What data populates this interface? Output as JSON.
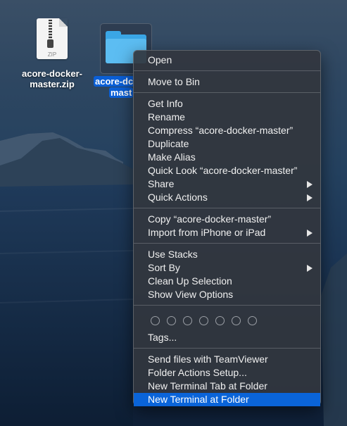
{
  "desktop": {
    "zip_file": {
      "label_line1": "acore-docker-",
      "label_line2": "master.zip",
      "type_tag": "ZIP",
      "icon": "zip-archive-icon"
    },
    "folder": {
      "label_line1": "acore-dc",
      "label_line2": "mast",
      "icon": "folder-icon"
    }
  },
  "menu": {
    "sections": [
      {
        "items": [
          {
            "label": "Open"
          }
        ]
      },
      {
        "items": [
          {
            "label": "Move to Bin"
          }
        ]
      },
      {
        "items": [
          {
            "label": "Get Info"
          },
          {
            "label": "Rename"
          },
          {
            "label": "Compress “acore-docker-master”"
          },
          {
            "label": "Duplicate"
          },
          {
            "label": "Make Alias"
          },
          {
            "label": "Quick Look “acore-docker-master”"
          },
          {
            "label": "Share",
            "submenu": true
          },
          {
            "label": "Quick Actions",
            "submenu": true
          }
        ]
      },
      {
        "items": [
          {
            "label": "Copy “acore-docker-master”"
          },
          {
            "label": "Import from iPhone or iPad",
            "submenu": true
          }
        ]
      },
      {
        "items": [
          {
            "label": "Use Stacks"
          },
          {
            "label": "Sort By",
            "submenu": true
          },
          {
            "label": "Clean Up Selection"
          },
          {
            "label": "Show View Options"
          }
        ]
      },
      {
        "tags": {
          "count": 7,
          "label": "Tags..."
        }
      },
      {
        "items": [
          {
            "label": "Send files with TeamViewer"
          },
          {
            "label": "Folder Actions Setup..."
          },
          {
            "label": "New Terminal Tab at Folder"
          },
          {
            "label": "New Terminal at Folder",
            "highlighted": true
          }
        ]
      }
    ]
  },
  "colors": {
    "highlight": "#0a64d9",
    "selection_label": "#0a5fd6",
    "folder": "#5cbdf2"
  }
}
